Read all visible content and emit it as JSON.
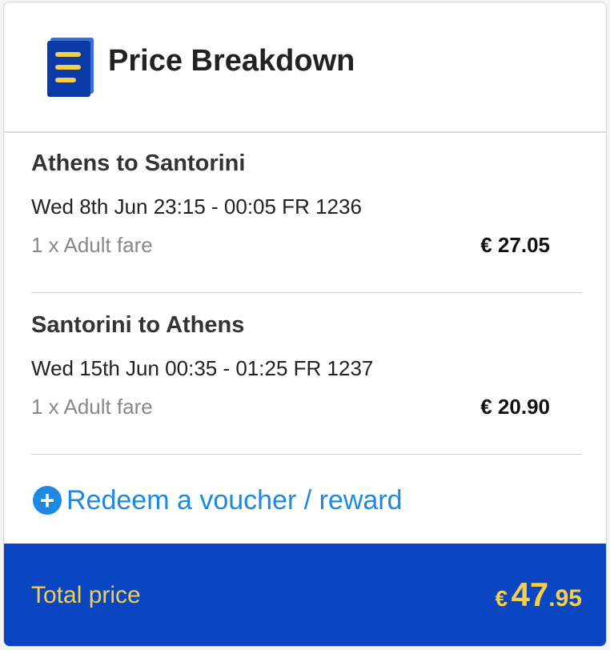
{
  "header": {
    "title": "Price Breakdown",
    "icon": "price-breakdown-list-icon"
  },
  "segments": [
    {
      "route": "Athens to Santorini",
      "times": "Wed 8th Jun 23:15 - 00:05 FR 1236",
      "fare": "1 x Adult fare",
      "amount": "€ 27.05"
    },
    {
      "route": "Santorini to Athens",
      "times": "Wed 15th Jun 00:35 - 01:25 FR 1237",
      "fare": "1 x Adult fare",
      "amount": "€ 20.90"
    }
  ],
  "voucher": {
    "icon": "plus-circle-icon",
    "label": "Redeem a voucher / reward"
  },
  "total": {
    "label": "Total price",
    "currency": "€",
    "whole": "47",
    "cents": ".95"
  },
  "colors": {
    "brand_blue": "#0a45c2",
    "accent_yellow": "#f5cf4a",
    "link_blue": "#1e88e5"
  }
}
